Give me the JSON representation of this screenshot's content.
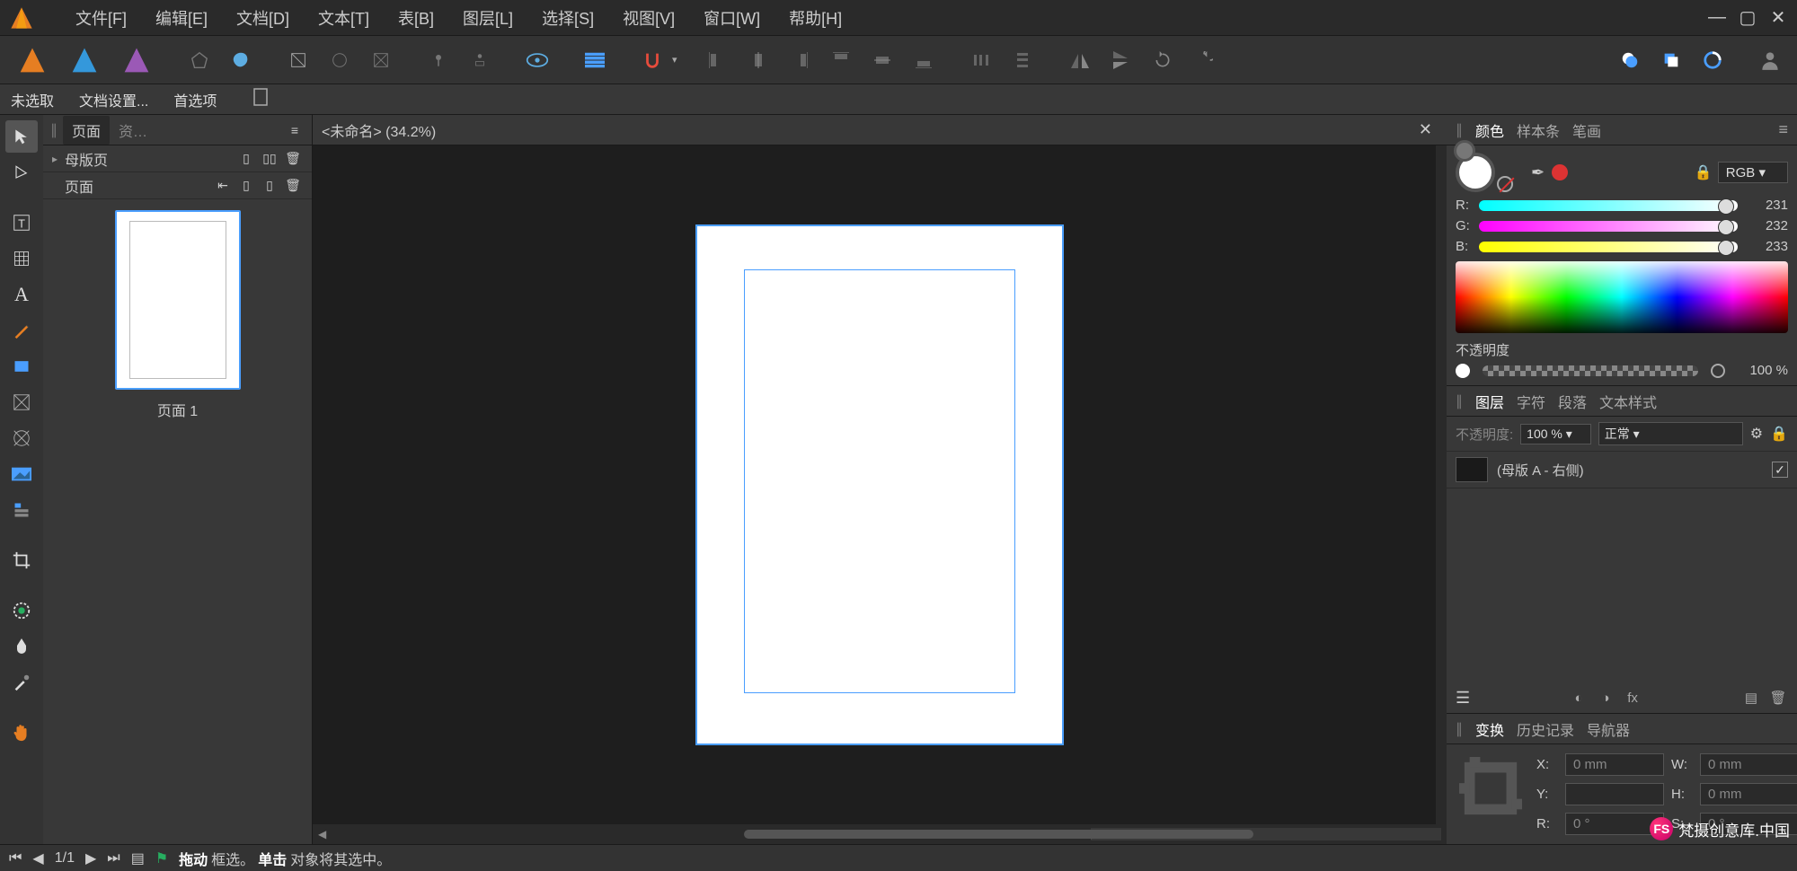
{
  "menubar": {
    "items": [
      "文件[F]",
      "编辑[E]",
      "文档[D]",
      "文本[T]",
      "表[B]",
      "图层[L]",
      "选择[S]",
      "视图[V]",
      "窗口[W]",
      "帮助[H]"
    ]
  },
  "contextbar": {
    "selection": "未选取",
    "doc_settings": "文档设置...",
    "preferences": "首选项"
  },
  "pages_panel": {
    "tab": "页面",
    "masters": "母版页",
    "pages": "页面",
    "page1_label": "页面 1"
  },
  "document": {
    "tab_title": "<未命名> (34.2%)"
  },
  "color_panel": {
    "tabs": [
      "颜色",
      "样本条",
      "笔画"
    ],
    "mode": "RGB",
    "r_label": "R:",
    "r_value": "231",
    "g_label": "G:",
    "g_value": "232",
    "b_label": "B:",
    "b_value": "233",
    "opacity_label": "不透明度",
    "opacity_value": "100 %"
  },
  "layers_panel": {
    "tabs": [
      "图层",
      "字符",
      "段落",
      "文本样式"
    ],
    "opacity_label": "不透明度:",
    "opacity_value": "100 %",
    "blend_mode": "正常",
    "layer_name": "(母版 A - 右侧)"
  },
  "transform_panel": {
    "tabs": [
      "变换",
      "历史记录",
      "导航器"
    ],
    "x_label": "X:",
    "x_value": "0 mm",
    "y_label": "Y:",
    "y_value": "",
    "w_label": "W:",
    "w_value": "0 mm",
    "h_label": "H:",
    "h_value": "0 mm",
    "r_label": "R:",
    "r_value": "0 °",
    "s_label": "S:",
    "s_value": "0 °"
  },
  "statusbar": {
    "page_counter": "1/1",
    "hint_drag": "拖动",
    "hint_drag_after": "框选。",
    "hint_click": "单击",
    "hint_click_after": "对象将其选中。"
  },
  "watermark": {
    "text": "梵摄创意库.中国",
    "badge": "FS"
  }
}
